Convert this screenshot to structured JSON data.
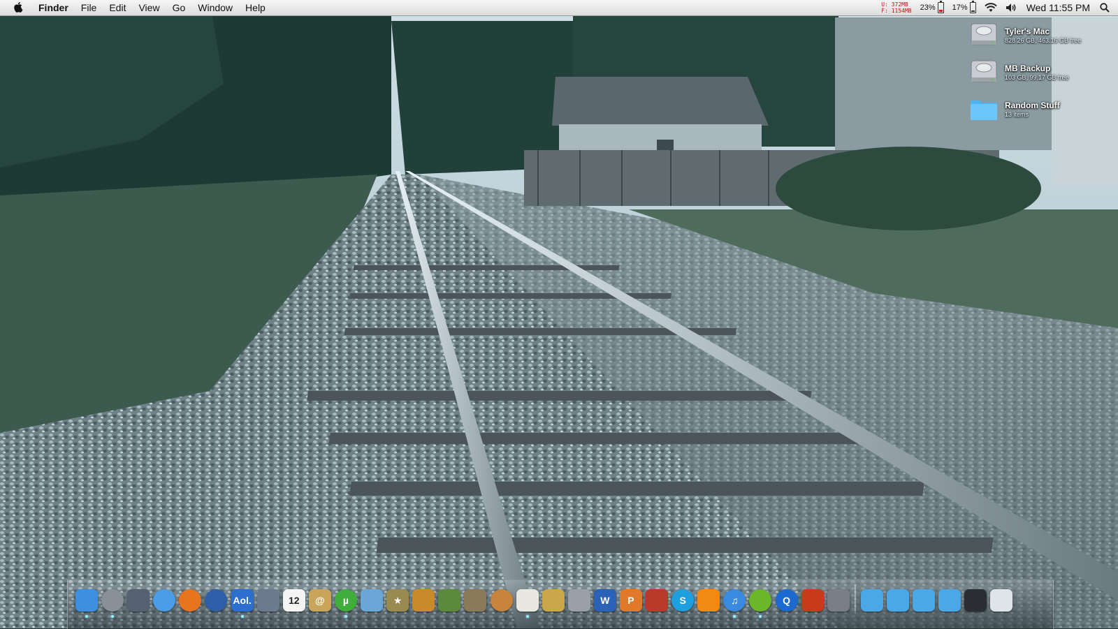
{
  "menubar": {
    "apple_icon": "apple-logo",
    "app_name": "Finder",
    "menus": [
      "File",
      "Edit",
      "View",
      "Go",
      "Window",
      "Help"
    ],
    "memory_used": "U:  372MB",
    "memory_free": "F: 1154MB",
    "cpu_percent": "23%",
    "battery_percent": "17%",
    "clock": "Wed 11:55 PM",
    "icons": [
      "battery-icon",
      "wifi-icon",
      "volume-icon",
      "spotlight-search-icon"
    ]
  },
  "desktop": {
    "items": [
      {
        "name": "Tyler's Mac",
        "sub": "828.26 GB, 463.16 GB free",
        "icon": "hard-drive-icon"
      },
      {
        "name": "MB Backup",
        "sub": "103 GB, 99.17 GB free",
        "icon": "hard-drive-icon"
      },
      {
        "name": "Random Stuff",
        "sub": "13 items",
        "icon": "folder-icon"
      }
    ]
  },
  "dock": {
    "apps": [
      {
        "name": "finder-icon",
        "label": "",
        "color": "#3d8fe0"
      },
      {
        "name": "launchpad-icon",
        "label": "",
        "color": "#8a9099"
      },
      {
        "name": "mission-control-icon",
        "label": "",
        "color": "#556070"
      },
      {
        "name": "safari-icon",
        "label": "",
        "color": "#4a9ee8"
      },
      {
        "name": "firefox-icon",
        "label": "",
        "color": "#e8741e"
      },
      {
        "name": "network-globe-icon",
        "label": "",
        "color": "#2f5fa8"
      },
      {
        "name": "aol-icon",
        "label": "Aol.",
        "color": "#2c6fd0"
      },
      {
        "name": "preview-icon",
        "label": "",
        "color": "#6c7a8e"
      },
      {
        "name": "calendar-icon",
        "label": "12",
        "color": "#f4f4f4"
      },
      {
        "name": "contacts-icon",
        "label": "@",
        "color": "#c8a55a"
      },
      {
        "name": "utorrent-icon",
        "label": "µ",
        "color": "#3fae3a"
      },
      {
        "name": "folder-app-icon",
        "label": "",
        "color": "#6aa7d8"
      },
      {
        "name": "imovie-star-icon",
        "label": "★",
        "color": "#9a8a50"
      },
      {
        "name": "garageband-icon",
        "label": "",
        "color": "#c98a2c"
      },
      {
        "name": "minecraft-icon",
        "label": "",
        "color": "#5a8a3a"
      },
      {
        "name": "gimp-icon",
        "label": "",
        "color": "#8a7a5a"
      },
      {
        "name": "egg-icon",
        "label": "",
        "color": "#c8843a"
      },
      {
        "name": "textedit-icon",
        "label": "",
        "color": "#e8e8e0"
      },
      {
        "name": "script-editor-icon",
        "label": "",
        "color": "#c9a84a"
      },
      {
        "name": "calculator-icon",
        "label": "",
        "color": "#9aa0a8"
      },
      {
        "name": "word-icon",
        "label": "W",
        "color": "#2a62b8"
      },
      {
        "name": "powerpoint-icon",
        "label": "P",
        "color": "#e07a2a"
      },
      {
        "name": "photo-booth-icon",
        "label": "",
        "color": "#b83a2a"
      },
      {
        "name": "skype-icon",
        "label": "S",
        "color": "#1ea0e0"
      },
      {
        "name": "vlc-icon",
        "label": "",
        "color": "#f08a12"
      },
      {
        "name": "itunes-icon",
        "label": "♫",
        "color": "#3a8ae0"
      },
      {
        "name": "spotify-icon",
        "label": "",
        "color": "#6ab82a"
      },
      {
        "name": "quicktime-icon",
        "label": "Q",
        "color": "#1a6ad0"
      },
      {
        "name": "audio-app-icon",
        "label": "",
        "color": "#c83a1a"
      },
      {
        "name": "system-preferences-icon",
        "label": "",
        "color": "#7a7e86"
      }
    ],
    "stacks": [
      {
        "name": "applications-stack-icon",
        "color": "#4aa8e8"
      },
      {
        "name": "documents-stack-icon",
        "color": "#4aa8e8"
      },
      {
        "name": "folder-stack-icon",
        "color": "#4aa8e8"
      },
      {
        "name": "downloads-stack-icon",
        "color": "#4aa8e8"
      },
      {
        "name": "terminal-stack-icon",
        "color": "#2a2e33"
      },
      {
        "name": "trash-icon",
        "color": "#dfe4e8"
      }
    ]
  }
}
